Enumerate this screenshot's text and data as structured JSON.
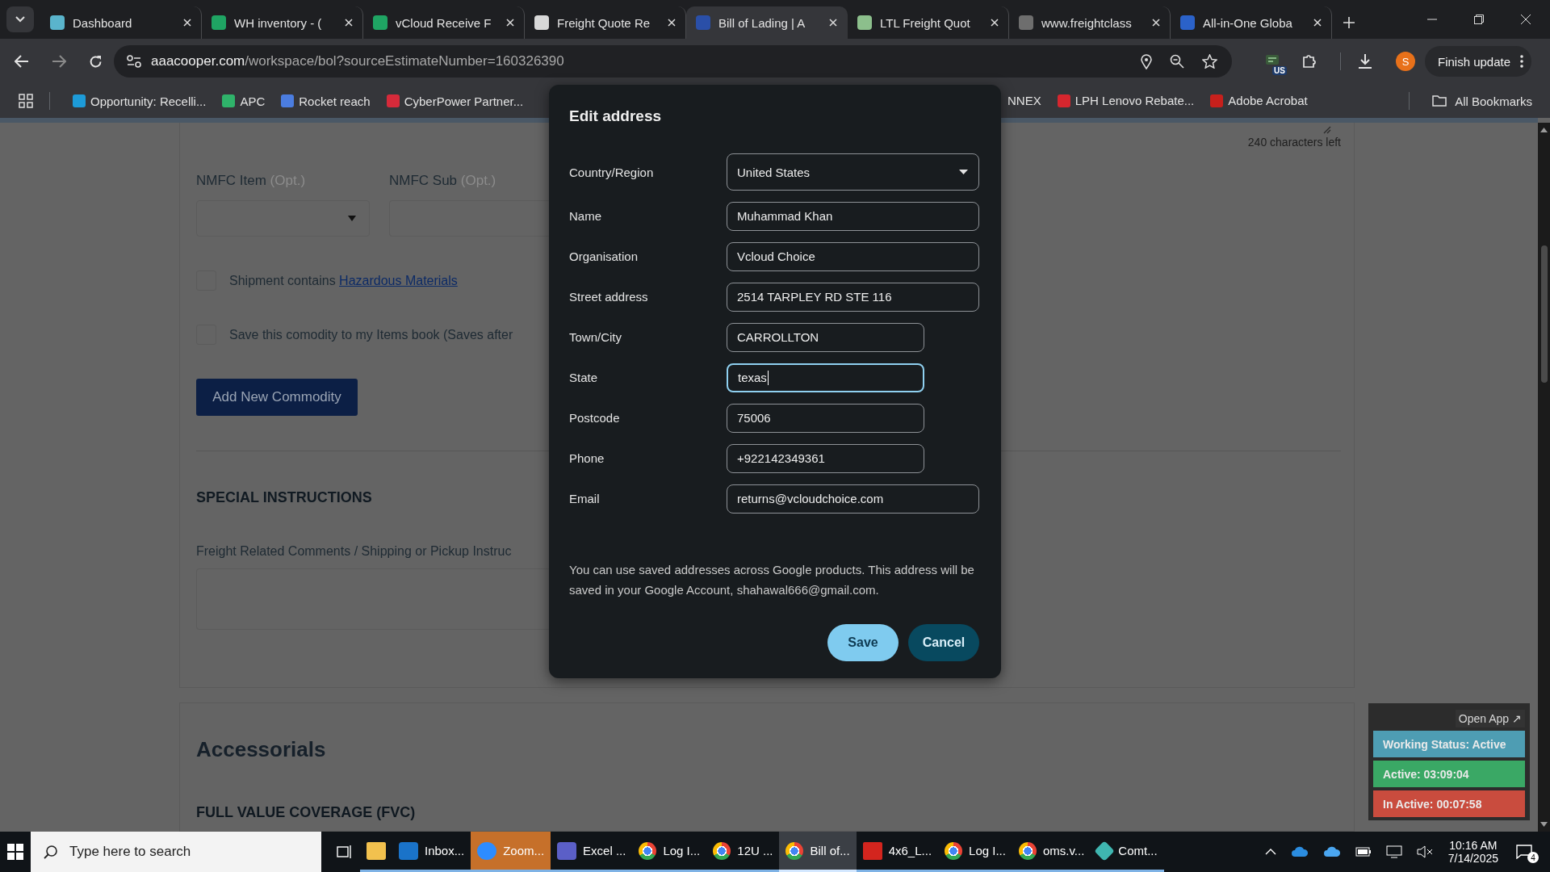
{
  "browser": {
    "tabs": [
      {
        "title": "Dashboard",
        "color": "#5ab4cc",
        "selected": false
      },
      {
        "title": "WH inventory - (",
        "color": "#1fa463",
        "selected": false
      },
      {
        "title": "vCloud Receive F",
        "color": "#1fa463",
        "selected": false
      },
      {
        "title": "Freight Quote Re",
        "color": "#d8d8d8",
        "selected": false
      },
      {
        "title": "Bill of Lading | A",
        "color": "#2a4fa8",
        "selected": true
      },
      {
        "title": "LTL Freight Quot",
        "color": "#8cbf8c",
        "selected": false
      },
      {
        "title": "www.freightclass",
        "color": "#6e6e6e",
        "selected": false
      },
      {
        "title": "All-in-One Globa",
        "color": "#2b62c9",
        "selected": false
      }
    ],
    "url": {
      "host": "aaacooper.com",
      "path": "/workspace/bol?sourceEstimateNumber=160326390"
    },
    "extension_badge": "US",
    "profile_initial": "S",
    "update_button": "Finish update",
    "bookmarks": [
      {
        "label": "Opportunity: Recelli...",
        "color": "#1d9bd8"
      },
      {
        "label": "APC",
        "color": "#2fb36a"
      },
      {
        "label": "Rocket reach",
        "color": "#4b7de0"
      },
      {
        "label": "CyberPower Partner...",
        "color": "#d62a3a"
      },
      {
        "label": "NNEX"
      },
      {
        "label": "LPH Lenovo Rebate...",
        "color": "#d6262e"
      },
      {
        "label": "Adobe Acrobat",
        "color": "#c7201c"
      }
    ],
    "all_bookmarks": "All Bookmarks"
  },
  "page": {
    "char_count": "240 characters left",
    "nmfc": [
      {
        "label": "NMFC Item",
        "hint": "(Opt.)"
      },
      {
        "label": "NMFC Sub",
        "hint": "(Opt.)"
      }
    ],
    "checks": [
      {
        "text": "Shipment contains",
        "link": "Hazardous Materials",
        "checked": false
      },
      {
        "text": "Save this comodity to my Items book (Saves after",
        "checked": false
      }
    ],
    "add_button": "Add New Commodity",
    "section_title": "SPECIAL INSTRUCTIONS",
    "comments_label": "Freight Related Comments / Shipping or Pickup Instruc",
    "accessorials_title": "Accessorials",
    "fvc_title": "FULL VALUE COVERAGE (FVC)"
  },
  "dialog": {
    "title": "Edit address",
    "fields": [
      {
        "label": "Country/Region",
        "value": "United States",
        "kind": "select",
        "wide": true,
        "focused": false
      },
      {
        "label": "Name",
        "value": "Muhammad Khan",
        "kind": "text",
        "wide": true,
        "focused": false
      },
      {
        "label": "Organisation",
        "value": "Vcloud Choice",
        "kind": "text",
        "wide": true,
        "focused": false
      },
      {
        "label": "Street address",
        "value": "2514 TARPLEY RD STE 116",
        "kind": "text",
        "wide": true,
        "focused": false
      },
      {
        "label": "Town/City",
        "value": "CARROLLTON",
        "kind": "text",
        "wide": false,
        "focused": false
      },
      {
        "label": "State",
        "value": "texas",
        "kind": "text",
        "wide": false,
        "focused": true
      },
      {
        "label": "Postcode",
        "value": "75006",
        "kind": "text",
        "wide": false,
        "focused": false
      },
      {
        "label": "Phone",
        "value": "+922142349361",
        "kind": "text",
        "wide": false,
        "focused": false
      },
      {
        "label": "Email",
        "value": "returns@vcloudchoice.com",
        "kind": "text",
        "wide": true,
        "focused": false
      }
    ],
    "note": "You can use saved addresses across Google products. This address will be saved in your Google Account, shahawal666@gmail.com.",
    "save": "Save",
    "cancel": "Cancel"
  },
  "widget": {
    "open_app": "Open App ↗",
    "statuses": [
      {
        "text": "Working Status: Active",
        "color": "#4e9db3"
      },
      {
        "text": "Active: 03:09:04",
        "color": "#3aa865"
      },
      {
        "text": "In Active: 00:07:58",
        "color": "#c94c3e"
      }
    ]
  },
  "taskbar": {
    "search_placeholder": "Type here to search",
    "apps": [
      {
        "kind": "explorer",
        "selected": false,
        "attention": false
      },
      {
        "kind": "outlook",
        "label": "Inbox...",
        "selected": false,
        "attention": false
      },
      {
        "kind": "zoom",
        "label": "Zoom...",
        "selected": false,
        "attention": true
      },
      {
        "kind": "teams",
        "label": "Excel ...",
        "selected": false,
        "attention": false
      },
      {
        "kind": "chrome",
        "label": "Log I...",
        "selected": false,
        "attention": false
      },
      {
        "kind": "chrome",
        "label": "12U ...",
        "selected": false,
        "attention": false
      },
      {
        "kind": "chrome",
        "label": "Bill of...",
        "selected": true,
        "attention": false
      },
      {
        "kind": "acrobat",
        "label": "4x6_L...",
        "selected": false,
        "attention": false
      },
      {
        "kind": "chrome",
        "label": "Log I...",
        "selected": false,
        "attention": false
      },
      {
        "kind": "chrome",
        "label": "oms.v...",
        "selected": false,
        "attention": false
      },
      {
        "kind": "app",
        "label": "Comt...",
        "selected": false,
        "attention": false
      }
    ],
    "time": "10:16 AM",
    "date": "7/14/2025",
    "notifications": "4"
  }
}
